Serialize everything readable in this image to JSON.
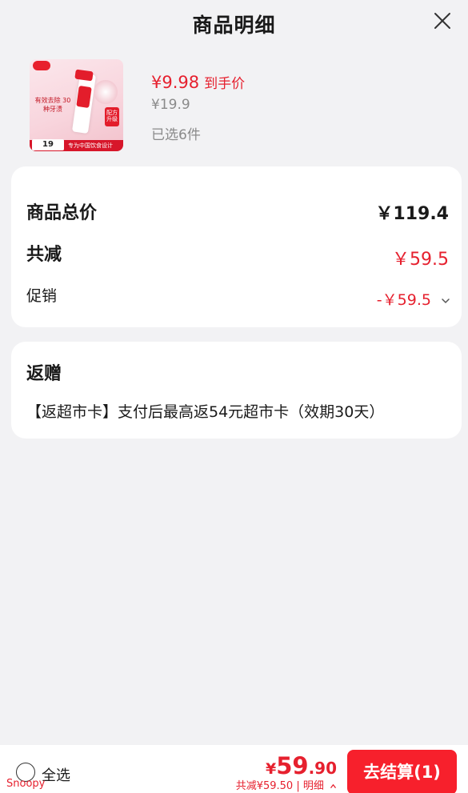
{
  "header": {
    "title": "商品明细",
    "close_icon": "close-icon"
  },
  "product": {
    "price_now": "¥9.98",
    "price_label": "到手价",
    "original_price": "¥19.9",
    "selected_count": "已选6件",
    "thumbnail": {
      "promo_text": "有效去除 30种牙渍",
      "badge_text": "配方 升级",
      "bottom_text": "专为中国饮食设计",
      "price_text": "19"
    }
  },
  "summary": {
    "total_label": "商品总价",
    "total_value": "￥119.4",
    "reduce_label": "共减",
    "reduce_value": "￥59.5",
    "promo_label": "促销",
    "promo_value": "-￥59.5"
  },
  "gift": {
    "title": "返赠",
    "description": "【返超市卡】支付后最高返54元超市卡（效期30天）"
  },
  "bottom_bar": {
    "select_all_label": "全选",
    "watermark": "Snoopy",
    "pay_currency": "¥",
    "pay_integer": "59",
    "pay_decimal": ".90",
    "pay_detail": "共减¥59.50 | 明细",
    "checkout_label": "去结算(1)"
  },
  "colors": {
    "accent": "#e6202e",
    "checkout": "#f7202c",
    "background": "#f2f2f4"
  }
}
